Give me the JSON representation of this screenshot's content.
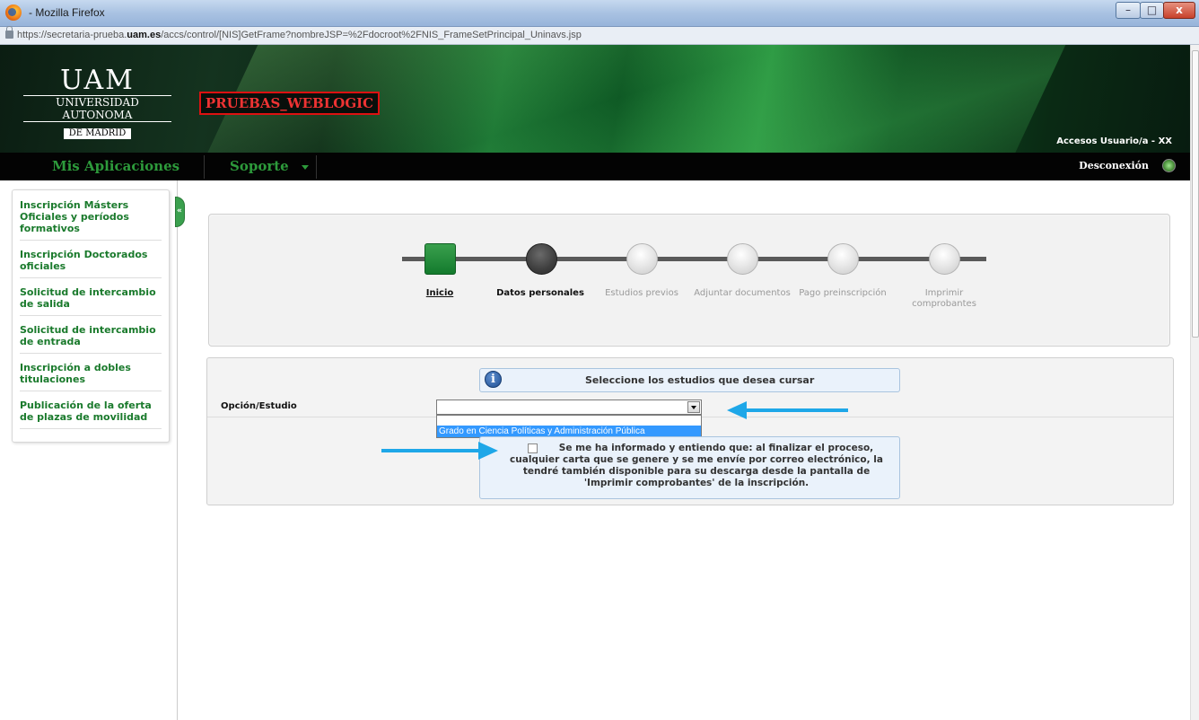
{
  "window": {
    "title": "- Mozilla Firefox",
    "minimize_glyph": "–",
    "maximize_glyph": "□",
    "close_glyph": "x"
  },
  "urlbar": {
    "prefix": "https://secretaria-prueba.",
    "domain": "uam.es",
    "path": "/accs/control/[NIS]GetFrame?nombreJSP=%2Fdocroot%2FNIS_FrameSetPrincipal_Uninavs.jsp"
  },
  "header": {
    "logo_big": "UAM",
    "logo_line": "UNIVERSIDAD AUTONOMA",
    "logo_madrid": "DE MADRID",
    "environment": "PRUEBAS_WEBLOGIC",
    "access": "Accesos Usuario/a - XX"
  },
  "nav": {
    "apps": "Mis Aplicaciones",
    "support": "Soporte",
    "logout": "Desconexión"
  },
  "sidebar": {
    "collapse_glyph": "«",
    "items": [
      {
        "label": "Inscripción Másters Oficiales y períodos formativos"
      },
      {
        "label": "Inscripción Doctorados oficiales"
      },
      {
        "label": "Solicitud de intercambio de salida"
      },
      {
        "label": "Solicitud de intercambio de entrada"
      },
      {
        "label": "Inscripción a dobles titulaciones"
      },
      {
        "label": "Publicación de la oferta de plazas de movilidad"
      }
    ]
  },
  "steps": [
    {
      "label": "Inicio",
      "state": "done"
    },
    {
      "label": "Datos personales",
      "state": "current"
    },
    {
      "label": "Estudios previos",
      "state": "pending"
    },
    {
      "label": "Adjuntar documentos",
      "state": "pending"
    },
    {
      "label": "Pago preinscripción",
      "state": "pending"
    },
    {
      "label": "Imprimir comprobantes",
      "state": "pending"
    }
  ],
  "form": {
    "info_glyph": "i",
    "info_message": "Seleccione los estudios que desea cursar",
    "field_label": "Opción/Estudio",
    "select_value": "",
    "dropdown_option": "Grado en Ciencia Políticas y Administración Pública",
    "consent_text": "Se me ha informado y entiendo que: al finalizar el proceso, cualquier carta que se genere y se me envíe por correo electrónico, la tendré también disponible para su descarga desde la pantalla de 'Imprimir comprobantes' de la inscripción.",
    "consent_checked": false
  },
  "colors": {
    "brand_green": "#1a7a2c",
    "annotation_arrow": "#1ea7e8",
    "selected_option": "#3399ff"
  }
}
